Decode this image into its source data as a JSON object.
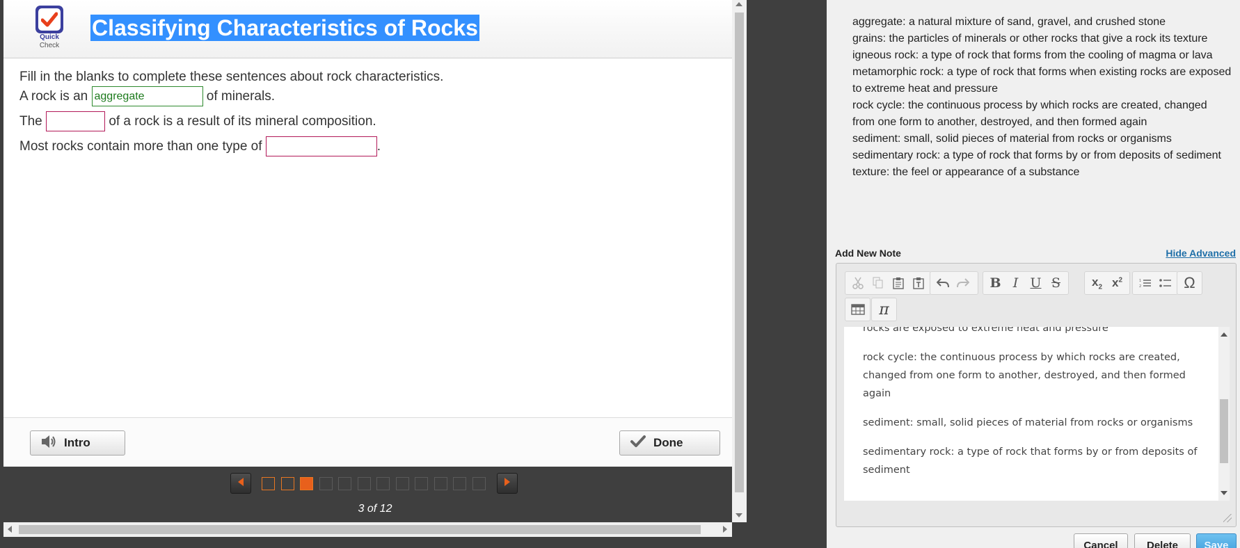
{
  "activity": {
    "logo_line1": "Quick",
    "logo_line2": "Check",
    "title": "Classifying Characteristics of Rocks"
  },
  "question": {
    "instructions": "Fill in the blanks to complete these sentences about rock characteristics.",
    "sentence1": {
      "before": "A rock is an",
      "answer": "aggregate",
      "after": "of minerals."
    },
    "sentence2": {
      "before": "The",
      "answer": "",
      "after": "of a rock is a result of its mineral composition."
    },
    "sentence3": {
      "before": "Most rocks contain more than one type of",
      "answer": "",
      "after": "."
    }
  },
  "footer": {
    "intro_label": "Intro",
    "done_label": "Done"
  },
  "navigation": {
    "current_page": 3,
    "total_pages": 12,
    "page_count_text": "3 of 12",
    "accent_color": "#e8601c"
  },
  "notes_panel": {
    "glossary": [
      "aggregate: a natural mixture of sand, gravel, and crushed stone",
      "grains: the particles of minerals or other rocks that give a rock its texture",
      "igneous rock: a type of rock that forms from the cooling of magma or lava",
      "metamorphic rock: a type of rock that forms when existing rocks are exposed to extreme heat and pressure",
      "rock cycle: the continuous process by which rocks are created, changed from one form to another, destroyed, and then formed again",
      "sediment: small, solid pieces of material from rocks or organisms",
      "sedimentary rock: a type of rock that forms by or from deposits of sediment",
      "texture: the feel or appearance of a substance"
    ],
    "add_note_label": "Add New Note",
    "hide_advanced_label": "Hide Advanced",
    "toolbar": {
      "row1": [
        [
          "cut-icon",
          "copy-icon",
          "paste-icon",
          "paste-text-icon"
        ],
        [
          "undo-icon",
          "redo-icon"
        ],
        [
          "bold-icon",
          "italic-icon",
          "underline-icon",
          "strikethrough-icon"
        ],
        [
          "subscript-icon",
          "superscript-icon"
        ],
        [
          "numbered-list-icon",
          "bulleted-list-icon"
        ],
        [
          "special-character-icon"
        ]
      ],
      "row2": [
        [
          "table-icon"
        ],
        [
          "pi-icon"
        ]
      ]
    },
    "editor_text": [
      "rocks are exposed to extreme heat and pressure",
      "rock cycle: the continuous process by which rocks are created, changed from one form to another, destroyed, and then formed again",
      "sediment: small, solid pieces of material from rocks or organisms",
      "sedimentary rock: a type of rock that forms by or from deposits of sediment"
    ],
    "cancel_label": "Cancel",
    "delete_label": "Delete",
    "save_label": "Save"
  }
}
